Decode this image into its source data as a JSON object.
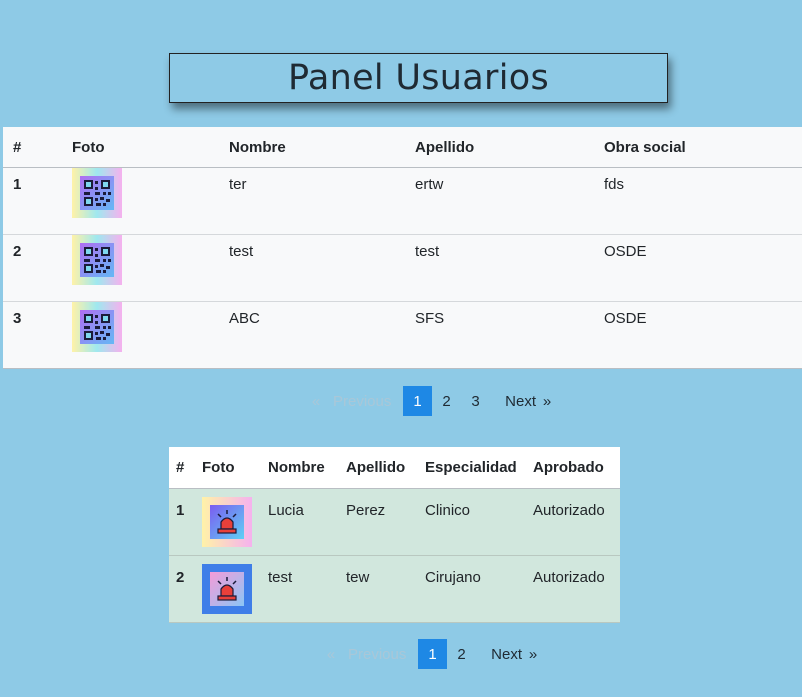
{
  "page": {
    "title": "Panel Usuarios"
  },
  "users_table": {
    "headers": [
      "#",
      "Foto",
      "Nombre",
      "Apellido",
      "Obra social"
    ],
    "rows": [
      {
        "num": "1",
        "nombre": "ter",
        "apellido": "ertw",
        "obra_social": "fds"
      },
      {
        "num": "2",
        "nombre": "test",
        "apellido": "test",
        "obra_social": "OSDE"
      },
      {
        "num": "3",
        "nombre": "ABC",
        "apellido": "SFS",
        "obra_social": "OSDE"
      }
    ],
    "photo_icon": "qr-code-icon"
  },
  "users_pagination": {
    "prev_arrow": "«",
    "prev_label": "Previous",
    "pages": [
      "1",
      "2",
      "3"
    ],
    "active_page": "1",
    "next_label": "Next",
    "next_arrow": "»"
  },
  "doctors_table": {
    "headers": [
      "#",
      "Foto",
      "Nombre",
      "Apellido",
      "Especialidad",
      "Aprobado"
    ],
    "rows": [
      {
        "num": "1",
        "nombre": "Lucia",
        "apellido": "Perez",
        "especialidad": "Clinico",
        "aprobado": "Autorizado"
      },
      {
        "num": "2",
        "nombre": "test",
        "apellido": "tew",
        "especialidad": "Cirujano",
        "aprobado": "Autorizado"
      }
    ],
    "photo_icon": "siren-icon"
  },
  "doctors_pagination": {
    "prev_arrow": "«",
    "prev_label": "Previous",
    "pages": [
      "1",
      "2"
    ],
    "active_page": "1",
    "next_label": "Next",
    "next_arrow": "»"
  },
  "colors": {
    "background": "#8ecae6",
    "active_page": "#1e88e5",
    "doctor_row": "#d1e7dd",
    "user_table": "#f8f9fa"
  }
}
